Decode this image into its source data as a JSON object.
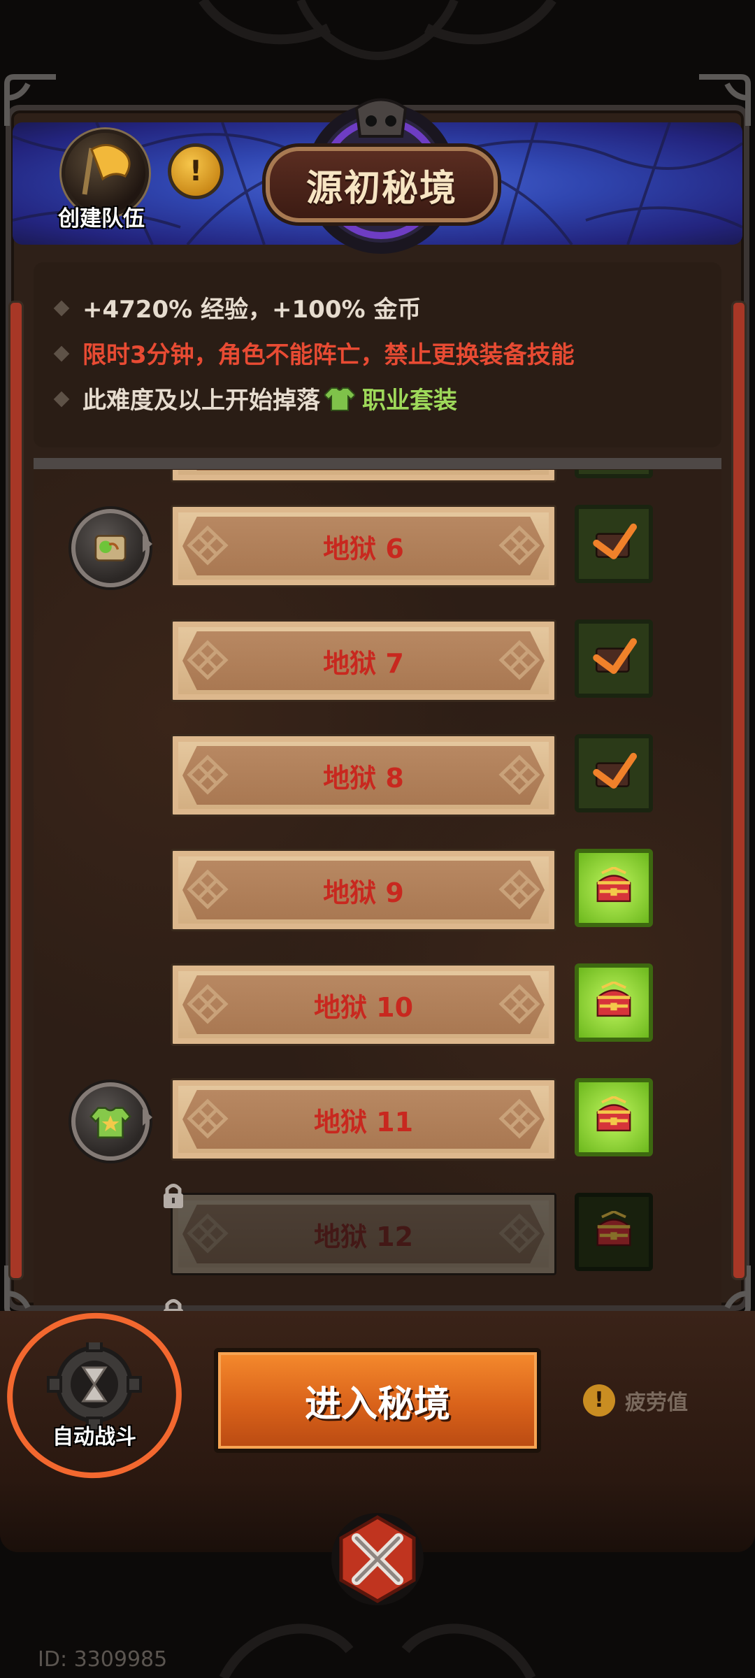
{
  "header": {
    "title": "源初秘境",
    "team_button_label": "创建队伍",
    "info_button_glyph": "!"
  },
  "info": {
    "line1": "+4720% 经验，+100% 金币",
    "line2": "限时3分钟，角色不能阵亡，禁止更换装备技能",
    "line3_prefix": "此难度及以上开始掉落",
    "line3_highlight": "职业套装"
  },
  "levels": [
    {
      "label": "地狱 6",
      "reward": "claimed",
      "locked": false,
      "medal": "scroll-icon"
    },
    {
      "label": "地狱 7",
      "reward": "claimed",
      "locked": false
    },
    {
      "label": "地狱 8",
      "reward": "claimed",
      "locked": false
    },
    {
      "label": "地狱 9",
      "reward": "available",
      "locked": false
    },
    {
      "label": "地狱 10",
      "reward": "available",
      "locked": false
    },
    {
      "label": "地狱 11",
      "reward": "available",
      "locked": false,
      "medal": "armor-star-icon"
    },
    {
      "label": "地狱 12",
      "reward": "locked",
      "locked": true
    }
  ],
  "bottom": {
    "auto_battle_label": "自动战斗",
    "enter_button_label": "进入秘境",
    "fatigue_label": "疲劳值",
    "fatigue_icon_glyph": "!"
  },
  "footer": {
    "id_text": "ID: 3309985"
  },
  "colors": {
    "level_text": "#c8281f",
    "warning_text": "#e84b33",
    "highlight_text": "#9ed95a",
    "enter_button": "#e06f1f",
    "annotation_circle": "#f3682f"
  }
}
